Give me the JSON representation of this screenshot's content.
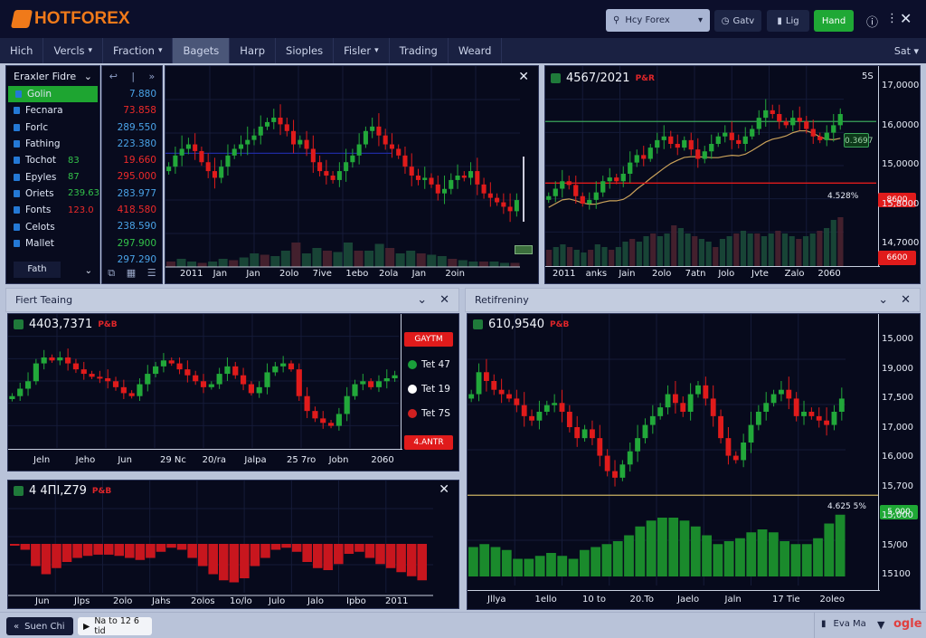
{
  "header": {
    "brand": "HOTFOREX",
    "search": "Hcy Forex",
    "btn_gatv": "Gatv",
    "btn_lig": "Lig",
    "btn_hand": "Hand"
  },
  "nav": {
    "items": [
      "Hich",
      "Vercls",
      "Fraction",
      "Bagets",
      "Harp",
      "Sioples",
      "Fisler",
      "Trading",
      "Weard"
    ],
    "active": 3,
    "right": "Sat"
  },
  "sidebar": {
    "title": "Eraxler Fidre",
    "items": [
      {
        "label": "Golin"
      },
      {
        "label": "Fecnara"
      },
      {
        "label": "Forlc"
      },
      {
        "label": "Fathing"
      },
      {
        "label": "Tochot",
        "value": "83"
      },
      {
        "label": "Epyles",
        "value": "87"
      },
      {
        "label": "Oriets",
        "value": "239.63"
      },
      {
        "label": "Fonts",
        "value": "123.0"
      },
      {
        "label": "Celots"
      },
      {
        "label": "Mallet"
      }
    ],
    "footer": "Fath",
    "prices": [
      {
        "v": "7.880",
        "c": "blue"
      },
      {
        "v": "73.858",
        "c": "red"
      },
      {
        "v": "289.550",
        "c": "blue"
      },
      {
        "v": "223.380",
        "c": "blue"
      },
      {
        "v": "19.660",
        "c": "red"
      },
      {
        "v": "295.000",
        "c": "red"
      },
      {
        "v": "283.977",
        "c": "blue"
      },
      {
        "v": "418.580",
        "c": "red"
      },
      {
        "v": "238.590",
        "c": "blue"
      },
      {
        "v": "297.900",
        "c": "green"
      },
      {
        "v": "297.290",
        "c": "blue"
      }
    ]
  },
  "colors": {
    "up": "#22a83a",
    "down": "#e01b1b",
    "accent": "#1ea531"
  },
  "chart1": {
    "x_labels": [
      "2011",
      "Jan",
      "Jan",
      "2olo",
      "7ive",
      "1ebo",
      "2ola",
      "Jan",
      "2oin"
    ],
    "ylim": [
      20,
      85
    ],
    "closes": [
      50,
      55,
      58,
      60,
      57,
      52,
      48,
      45,
      50,
      55,
      58,
      60,
      62,
      64,
      68,
      70,
      72,
      69,
      66,
      60,
      62,
      58,
      52,
      48,
      46,
      44,
      48,
      52,
      55,
      60,
      66,
      68,
      64,
      60,
      58,
      55,
      50,
      46,
      44,
      45,
      42,
      38,
      40,
      44,
      46,
      45,
      48,
      42,
      38,
      36,
      34,
      32,
      30,
      35
    ],
    "volume": [
      0.2,
      0.3,
      0.2,
      0.15,
      0.2,
      0.3,
      0.25,
      0.35,
      0.5,
      0.45,
      0.4,
      0.6,
      0.9,
      0.5,
      0.7,
      0.6,
      0.55,
      0.9,
      0.6,
      0.6,
      0.85,
      0.7,
      0.5,
      0.6,
      0.5,
      0.45,
      0.4,
      0.3,
      0.25,
      0.2,
      0.2,
      0.2,
      0.15,
      0.15
    ]
  },
  "chart2": {
    "title": "4567/2021",
    "tag": "P&R",
    "corner": "5S",
    "y_labels": [
      "17,0000",
      "16,0000",
      "15,0000",
      "15,8000",
      "14,7000"
    ],
    "badge_top": "8600",
    "badge_bottom": "6600",
    "line_label": "4.528%",
    "mark_label": "0.3697",
    "x_labels": [
      "2011",
      "anks",
      "Jain",
      "2olo",
      "7atn",
      "Jolo",
      "Jvte",
      "Zalo",
      "2060"
    ],
    "ylim": [
      10,
      90
    ],
    "closes": [
      30,
      34,
      38,
      36,
      30,
      26,
      28,
      32,
      38,
      40,
      38,
      42,
      48,
      52,
      50,
      56,
      60,
      62,
      58,
      56,
      60,
      55,
      50,
      54,
      58,
      62,
      64,
      60,
      58,
      62,
      66,
      72,
      76,
      74,
      70,
      68,
      72,
      70,
      66,
      62,
      60,
      64,
      68,
      74
    ],
    "volume": [
      0.3,
      0.35,
      0.4,
      0.35,
      0.3,
      0.25,
      0.3,
      0.4,
      0.35,
      0.3,
      0.35,
      0.45,
      0.5,
      0.45,
      0.55,
      0.6,
      0.55,
      0.6,
      0.75,
      0.7,
      0.6,
      0.55,
      0.5,
      0.45,
      0.35,
      0.5,
      0.55,
      0.6,
      0.65,
      0.6,
      0.6,
      0.55,
      0.6,
      0.65,
      0.6,
      0.55,
      0.5,
      0.55,
      0.6,
      0.65,
      0.7,
      0.85,
      0.9
    ]
  },
  "panel_left": {
    "title": "Fiert Teaing"
  },
  "chart3": {
    "title": "4403,7371",
    "tag": "P&B",
    "badge_top": "GAYTM",
    "badge_bottom": "4.ANTR",
    "legend": [
      {
        "label": "Tet 47",
        "color": "#1a9e3a"
      },
      {
        "label": "Tet 19",
        "color": "#ffffff"
      },
      {
        "label": "Tet 7S",
        "color": "#d02020"
      }
    ],
    "x_labels": [
      "Jeln",
      "Jeho",
      "Jun",
      "29 Nc",
      "20/ra",
      "Jalpa",
      "25 7ro",
      "Jobn",
      "2060"
    ],
    "ylim": [
      10,
      80
    ],
    "closes": [
      40,
      45,
      50,
      62,
      66,
      64,
      66,
      62,
      58,
      55,
      53,
      52,
      50,
      46,
      42,
      40,
      48,
      55,
      60,
      64,
      62,
      58,
      54,
      50,
      46,
      48,
      55,
      60,
      54,
      48,
      42,
      46,
      56,
      60,
      62,
      58,
      40,
      30,
      25,
      22,
      20,
      28,
      40,
      48,
      50,
      46,
      50,
      52,
      54
    ]
  },
  "chart5": {
    "title": "4 4ΠΙ,Ζ79",
    "tag": "P&B",
    "x_labels": [
      "Jun",
      "Jlps",
      "2olo",
      "Jahs",
      "2olos",
      "1o/lo",
      "Julo",
      "Jalo",
      "Ipbo",
      "2011"
    ],
    "values": [
      0,
      -0.1,
      -0.5,
      -0.7,
      -0.55,
      -0.4,
      -0.3,
      -0.25,
      -0.22,
      -0.22,
      -0.25,
      -0.3,
      -0.35,
      -0.3,
      -0.15,
      -0.05,
      -0.1,
      -0.3,
      -0.5,
      -0.7,
      -0.85,
      -0.9,
      -0.8,
      -0.5,
      -0.3,
      -0.1,
      -0.05,
      -0.15,
      -0.4,
      -0.55,
      -0.6,
      -0.45,
      -0.2,
      -0.15,
      -0.3,
      -0.45,
      -0.55,
      -0.65,
      -0.75,
      -0.85
    ]
  },
  "panel_right": {
    "title": "Retifreniny"
  },
  "chart4": {
    "title": "610,9540",
    "tag": "P&B",
    "y_labels": [
      "15,000",
      "19,000",
      "17,500",
      "17,000",
      "16,000",
      "15,700",
      "15,000",
      "15/00",
      "15100"
    ],
    "badge": "5,000",
    "line_label": "4.625 5%",
    "x_labels": [
      "Jllya",
      "1ello",
      "10 to",
      "20.To",
      "Jaelo",
      "Jaln",
      "17 Tie",
      "2oleo"
    ],
    "ylim": [
      10,
      80
    ],
    "closes": [
      60,
      70,
      66,
      62,
      60,
      58,
      55,
      50,
      48,
      52,
      55,
      56,
      52,
      45,
      40,
      44,
      40,
      32,
      25,
      22,
      28,
      34,
      40,
      46,
      50,
      54,
      60,
      56,
      52,
      60,
      64,
      58,
      50,
      40,
      32,
      30,
      38,
      46,
      52,
      56,
      60,
      62,
      58,
      50,
      52,
      50,
      48,
      46,
      52,
      58
    ],
    "volume": [
      0.5,
      0.55,
      0.5,
      0.45,
      0.3,
      0.3,
      0.35,
      0.4,
      0.35,
      0.3,
      0.45,
      0.5,
      0.55,
      0.6,
      0.7,
      0.85,
      0.95,
      1,
      1,
      0.95,
      0.85,
      0.7,
      0.55,
      0.6,
      0.65,
      0.75,
      0.8,
      0.75,
      0.6,
      0.55,
      0.55,
      0.65,
      0.9,
      1.05
    ]
  },
  "footer": {
    "btn_left": "Suen Chi",
    "btn_play": "Na to 12 6 tid",
    "user": "Eva Ma",
    "brand": "ogle"
  }
}
